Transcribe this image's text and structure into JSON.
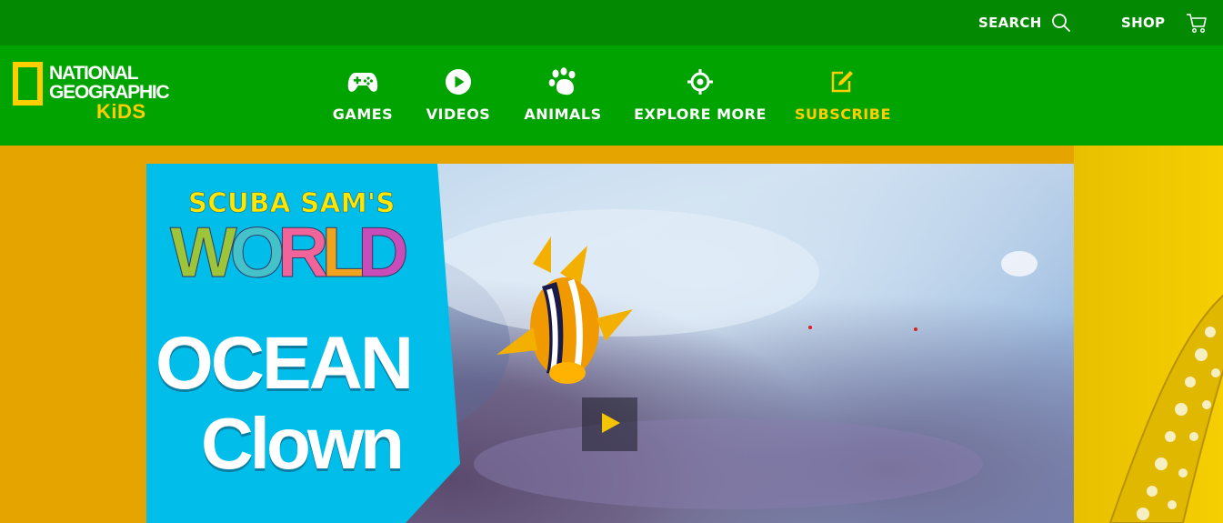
{
  "topbar": {
    "search_label": "SEARCH",
    "shop_label": "SHOP"
  },
  "brand": {
    "line1": "NATIONAL",
    "line2": "GEOGRAPHIC",
    "line3": "KiDS"
  },
  "nav": {
    "items": [
      {
        "label": "GAMES",
        "icon": "gamepad-icon"
      },
      {
        "label": "VIDEOS",
        "icon": "play-circle-icon"
      },
      {
        "label": "ANIMALS",
        "icon": "paw-print-icon"
      },
      {
        "label": "EXPLORE MORE",
        "icon": "crosshair-icon"
      },
      {
        "label": "SUBSCRIBE",
        "icon": "edit-icon"
      }
    ]
  },
  "hero": {
    "series_title": "SCUBA SAM'S",
    "series_world": "WORLD",
    "episode_line1": "OCEAN",
    "episode_line2": "Clown"
  },
  "colors": {
    "topbar": "#038a02",
    "navbar": "#01a300",
    "accent_yellow": "#ffce00",
    "page_bg": "#e6a400",
    "panel_blue": "#00bde9"
  }
}
